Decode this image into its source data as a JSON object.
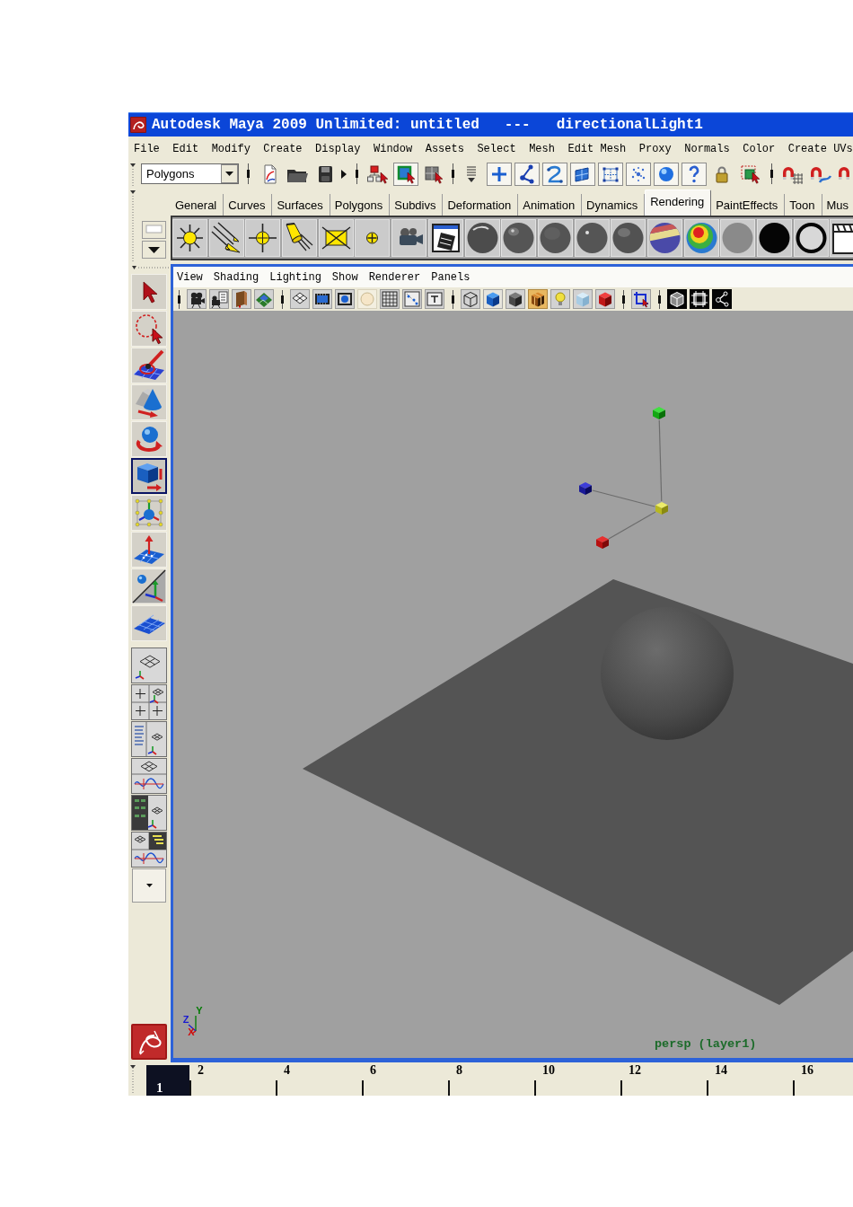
{
  "window": {
    "title": "Autodesk Maya 2009 Unlimited: untitled",
    "separator": "---",
    "selected_object": "directionalLight1"
  },
  "menu_bar": [
    "File",
    "Edit",
    "Modify",
    "Create",
    "Display",
    "Window",
    "Assets",
    "Select",
    "Mesh",
    "Edit Mesh",
    "Proxy",
    "Normals",
    "Color",
    "Create UVs"
  ],
  "status_line": {
    "mode_menu": "Polygons",
    "selection_modes": [
      {
        "selected": false
      },
      {
        "selected": true
      },
      {
        "selected": false
      }
    ],
    "mask_toggles": [
      {
        "on": true
      },
      {
        "on": true
      },
      {
        "on": true
      },
      {
        "on": true
      },
      {
        "on": true
      },
      {
        "on": true
      },
      {
        "on": true
      },
      {
        "on": true
      }
    ],
    "snap_toggles": [
      {
        "on": false
      },
      {
        "on": false
      },
      {
        "on": false
      }
    ]
  },
  "shelf": {
    "tabs": [
      {
        "label": "General",
        "selected": false
      },
      {
        "label": "Curves",
        "selected": false
      },
      {
        "label": "Surfaces",
        "selected": false
      },
      {
        "label": "Polygons",
        "selected": false
      },
      {
        "label": "Subdivs",
        "selected": false
      },
      {
        "label": "Deformation",
        "selected": false
      },
      {
        "label": "Animation",
        "selected": false
      },
      {
        "label": "Dynamics",
        "selected": false
      },
      {
        "label": "Rendering",
        "selected": true
      },
      {
        "label": "PaintEffects",
        "selected": false
      },
      {
        "label": "Toon",
        "selected": false
      },
      {
        "label": "Mus",
        "selected": false
      }
    ]
  },
  "toolbox": {
    "tools": [
      {
        "selected": false
      },
      {
        "selected": false
      },
      {
        "selected": false
      },
      {
        "selected": false
      },
      {
        "selected": false
      },
      {
        "selected": true
      },
      {
        "selected": false
      },
      {
        "selected": false
      },
      {
        "selected": false
      },
      {
        "selected": false
      }
    ]
  },
  "viewport": {
    "menu": [
      "View",
      "Shading",
      "Lighting",
      "Show",
      "Renderer",
      "Panels"
    ],
    "axis_labels": [
      {
        "text": "Z",
        "color": "#1a1ad0"
      },
      {
        "text": "Y",
        "color": "#007a00"
      },
      {
        "text": "X",
        "color": "#d00a0a"
      }
    ],
    "camera_label": "persp (layer1)"
  },
  "time_slider": {
    "current_frame": "1",
    "labels": [
      "2",
      "4",
      "6",
      "8",
      "10",
      "12",
      "14",
      "16"
    ]
  }
}
